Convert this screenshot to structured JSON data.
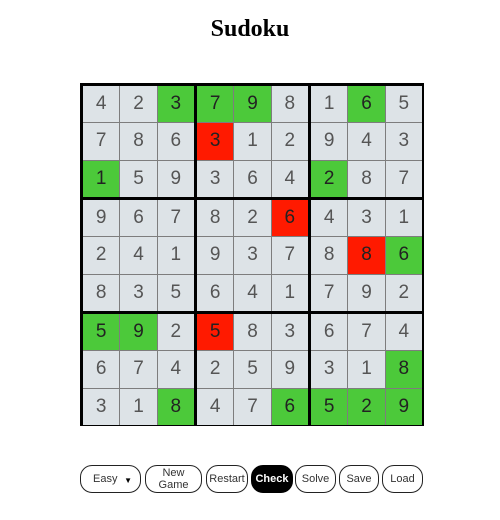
{
  "title": "Sudoku",
  "colors": {
    "cell_default": "#dde3e7",
    "cell_correct": "#4cc93a",
    "cell_wrong": "#ff1a00"
  },
  "grid": [
    [
      "4",
      "2",
      "3",
      "7",
      "9",
      "8",
      "1",
      "6",
      "5"
    ],
    [
      "7",
      "8",
      "6",
      "3",
      "1",
      "2",
      "9",
      "4",
      "3"
    ],
    [
      "1",
      "5",
      "9",
      "3",
      "6",
      "4",
      "2",
      "8",
      "7"
    ],
    [
      "9",
      "6",
      "7",
      "8",
      "2",
      "6",
      "4",
      "3",
      "1"
    ],
    [
      "2",
      "4",
      "1",
      "9",
      "3",
      "7",
      "8",
      "8",
      "6"
    ],
    [
      "8",
      "3",
      "5",
      "6",
      "4",
      "1",
      "7",
      "9",
      "2"
    ],
    [
      "5",
      "9",
      "2",
      "5",
      "8",
      "3",
      "6",
      "7",
      "4"
    ],
    [
      "6",
      "7",
      "4",
      "2",
      "5",
      "9",
      "3",
      "1",
      "8"
    ],
    [
      "3",
      "1",
      "8",
      "4",
      "7",
      "6",
      "5",
      "2",
      "9"
    ]
  ],
  "cell_states": [
    [
      "n",
      "n",
      "g",
      "g",
      "g",
      "n",
      "n",
      "g",
      "n"
    ],
    [
      "n",
      "n",
      "n",
      "r",
      "n",
      "n",
      "n",
      "n",
      "n"
    ],
    [
      "g",
      "n",
      "n",
      "n",
      "n",
      "n",
      "g",
      "n",
      "n"
    ],
    [
      "n",
      "n",
      "n",
      "n",
      "n",
      "r",
      "n",
      "n",
      "n"
    ],
    [
      "n",
      "n",
      "n",
      "n",
      "n",
      "n",
      "n",
      "r",
      "g"
    ],
    [
      "n",
      "n",
      "n",
      "n",
      "n",
      "n",
      "n",
      "n",
      "n"
    ],
    [
      "g",
      "g",
      "n",
      "r",
      "n",
      "n",
      "n",
      "n",
      "n"
    ],
    [
      "n",
      "n",
      "n",
      "n",
      "n",
      "n",
      "n",
      "n",
      "g"
    ],
    [
      "n",
      "n",
      "g",
      "n",
      "n",
      "g",
      "g",
      "g",
      "g"
    ]
  ],
  "controls": {
    "difficulty_selected": "Easy",
    "new_game_line1": "New",
    "new_game_line2": "Game",
    "restart": "Restart",
    "check": "Check",
    "solve": "Solve",
    "save": "Save",
    "load": "Load",
    "caret_icon": "dropdown-caret-icon"
  }
}
